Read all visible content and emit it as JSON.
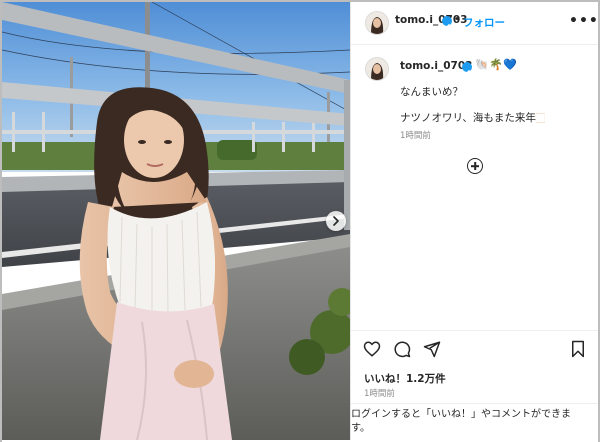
{
  "post": {
    "username": "tomo.i_0703",
    "follow_label": "フォロー",
    "more_label": "•••",
    "separator": "•",
    "caption": {
      "username": "tomo.i_0703",
      "emojis": [
        "🐚",
        "🌴",
        "💙"
      ],
      "line1": "なんまいめ？",
      "line2": "ナツノオワリ、海もまた来年",
      "line2_emoji": "🏻",
      "time": "1時間前"
    },
    "likes": "いいね！1.2万件",
    "time": "1時間前",
    "login_note": "ログインすると「いいね！」やコメントができます。"
  },
  "icons": {
    "verified": "verified-badge-icon",
    "like": "heart-icon",
    "comment": "comment-icon",
    "share": "paper-plane-icon",
    "save": "bookmark-icon",
    "more_replies": "plus-circle-icon",
    "next": "chevron-right-icon"
  },
  "colors": {
    "link_blue": "#0095f6",
    "verified_blue": "#1d9bf0",
    "text": "#262626",
    "muted": "#8e8e8e"
  }
}
